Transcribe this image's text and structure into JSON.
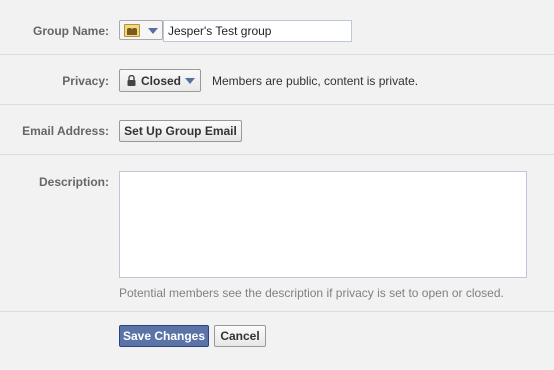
{
  "form": {
    "group_name": {
      "label": "Group Name:",
      "value": "Jesper's Test group"
    },
    "privacy": {
      "label": "Privacy:",
      "selected": "Closed",
      "description": "Members are public, content is private."
    },
    "email": {
      "label": "Email Address:",
      "button_label": "Set Up Group Email"
    },
    "description": {
      "label": "Description:",
      "value": "",
      "help": "Potential members see the description if privacy is set to open or closed."
    },
    "actions": {
      "save_label": "Save Changes",
      "cancel_label": "Cancel"
    }
  },
  "colors": {
    "background": "#f2f2f2",
    "label": "#666666",
    "primary_button": "#5b74a8",
    "input_border": "#bdc7d8",
    "help_text": "#808080"
  },
  "icons": [
    "group-icon",
    "dropdown-caret-icon",
    "lock-icon"
  ]
}
